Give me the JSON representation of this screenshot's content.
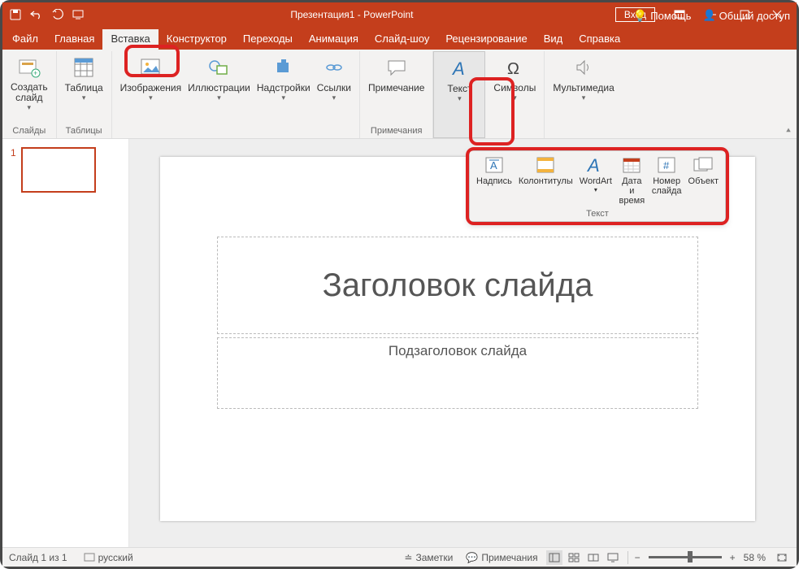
{
  "titlebar": {
    "title": "Презентация1 - PowerPoint",
    "signin": "Вход"
  },
  "tabs": [
    "Файл",
    "Главная",
    "Вставка",
    "Конструктор",
    "Переходы",
    "Анимация",
    "Слайд-шоу",
    "Рецензирование",
    "Вид",
    "Справка"
  ],
  "activeTab": "Вставка",
  "help": {
    "tellme": "Помощь",
    "share": "Общий доступ"
  },
  "ribbon": {
    "newSlide": "Создать\nслайд",
    "groups": {
      "slides": "Слайды",
      "tables": "Таблицы",
      "comments": "Примечания"
    },
    "buttons": {
      "table": "Таблица",
      "images": "Изображения",
      "illustrations": "Иллюстрации",
      "addins": "Надстройки",
      "links": "Ссылки",
      "comment": "Примечание",
      "text": "Текст",
      "symbols": "Символы",
      "media": "Мультимедиа"
    }
  },
  "popup": {
    "items": [
      "Надпись",
      "Колонтитулы",
      "WordArt",
      "Дата и\nвремя",
      "Номер\nслайда",
      "Объект"
    ],
    "label": "Текст"
  },
  "slide": {
    "title": "Заголовок слайда",
    "subtitle": "Подзаголовок слайда",
    "thumbNum": "1"
  },
  "status": {
    "slide": "Слайд 1 из 1",
    "lang": "русский",
    "notes": "Заметки",
    "comments": "Примечания",
    "zoom": "58 %"
  }
}
